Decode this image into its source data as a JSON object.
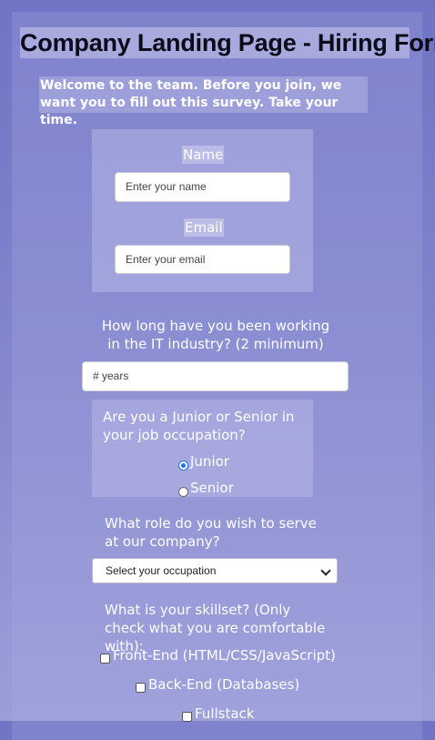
{
  "title": "Company Landing Page - Hiring Form",
  "intro": "Welcome to the team. Before you join, we want you to fill out this survey. Take your time.",
  "contact": {
    "name_label": "Name",
    "name_placeholder": "Enter your name",
    "email_label": "Email",
    "email_placeholder": "Enter your email"
  },
  "experience": {
    "question": "How long have you been working in the IT industry? (2 minimum)",
    "placeholder": "# years"
  },
  "level": {
    "question": "Are you a Junior or Senior in your job occupation?",
    "options": [
      {
        "label": "Junior",
        "checked": true
      },
      {
        "label": "Senior",
        "checked": false
      }
    ]
  },
  "role": {
    "question": "What role do you wish to serve at our company?",
    "selected": "Select your occupation"
  },
  "skills": {
    "question": "What is your skillset? (Only check what you are comfortable with):",
    "options": [
      {
        "label": "Front-End (HTML/CSS/JavaScript)",
        "checked": false
      },
      {
        "label": "Back-End (Databases)",
        "checked": false
      },
      {
        "label": "Fullstack",
        "checked": false
      }
    ]
  }
}
